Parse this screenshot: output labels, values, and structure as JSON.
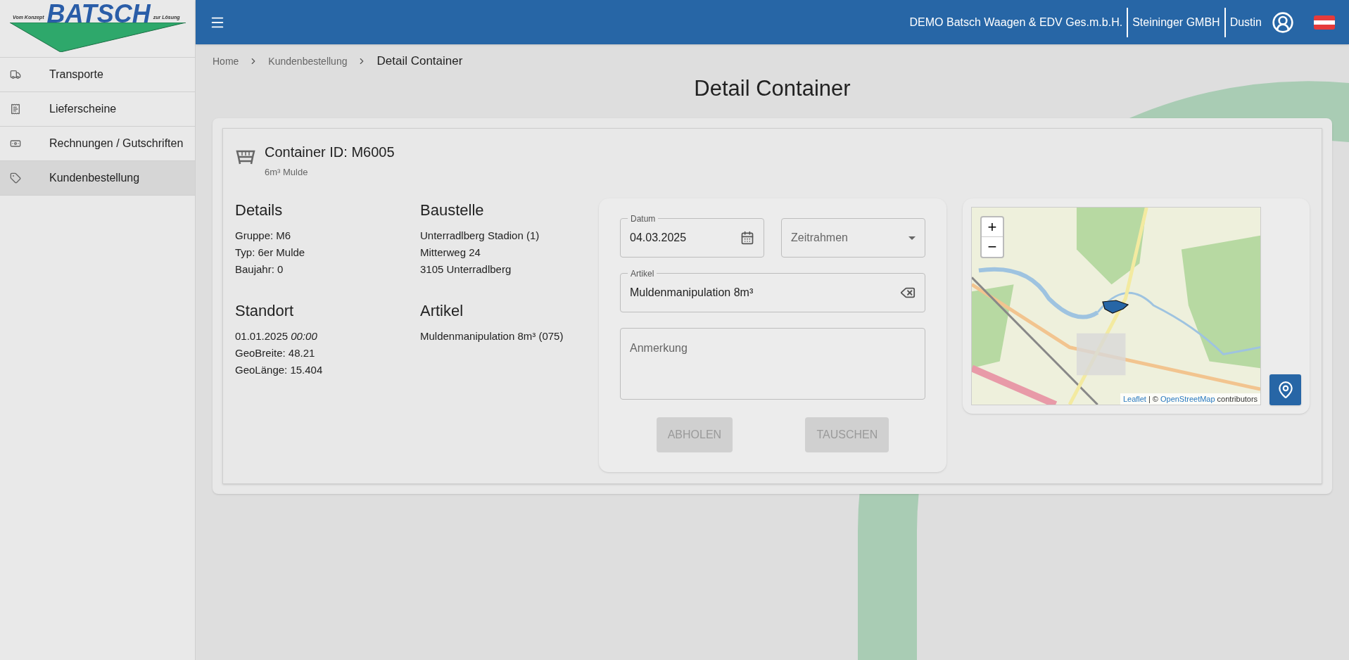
{
  "logo": {
    "name": "BATSCH",
    "left_slogan": "Vom Konzept",
    "right_slogan": "zur Lösung"
  },
  "sidebar": {
    "items": [
      {
        "label": "Transporte",
        "selected": false
      },
      {
        "label": "Lieferscheine",
        "selected": false
      },
      {
        "label": "Rechnungen / Gutschriften",
        "selected": false
      },
      {
        "label": "Kundenbestellung",
        "selected": true
      }
    ]
  },
  "header": {
    "company": "DEMO Batsch Waagen & EDV Ges.m.b.H.",
    "customer": "Steininger GMBH",
    "user": "Dustin"
  },
  "breadcrumb": [
    "Home",
    "Kundenbestellung",
    "Detail Container"
  ],
  "page_title": "Detail Container",
  "container": {
    "title": "Container ID: M6005",
    "subtitle": "6m³ Mulde",
    "sections": [
      {
        "heading": "Details",
        "lines": [
          "Gruppe: M6",
          "Typ: 6er Mulde",
          "Baujahr: 0"
        ]
      },
      {
        "heading": "Baustelle",
        "lines": [
          "Unterradlberg Stadion (1)",
          "Mitterweg 24",
          "3105 Unterradlberg"
        ]
      },
      {
        "heading": "Standort",
        "lines": [
          "01.01.2025 *00:00*",
          "GeoBreite: 48.21",
          "GeoLänge: 15.404"
        ]
      },
      {
        "heading": "Artikel",
        "lines": [
          "Muldenmanipulation 8m³ (075)"
        ]
      }
    ]
  },
  "form": {
    "date": {
      "label": "Datum",
      "value": "04.03.2025"
    },
    "timeframe": {
      "placeholder": "Zeitrahmen"
    },
    "article": {
      "label": "Artikel",
      "value": "Muldenmanipulation 8m³"
    },
    "note": {
      "placeholder": "Anmerkung"
    },
    "buttons": [
      {
        "label": "ABHOLEN",
        "disabled": true
      },
      {
        "label": "TAUSCHEN",
        "disabled": true
      }
    ]
  },
  "map": {
    "zoom_in": "+",
    "zoom_out": "−",
    "attribution_link": "Leaflet",
    "attribution_separator": "| ©",
    "attribution_source": "OpenStreetMap",
    "attribution_suffix": "contributors"
  }
}
